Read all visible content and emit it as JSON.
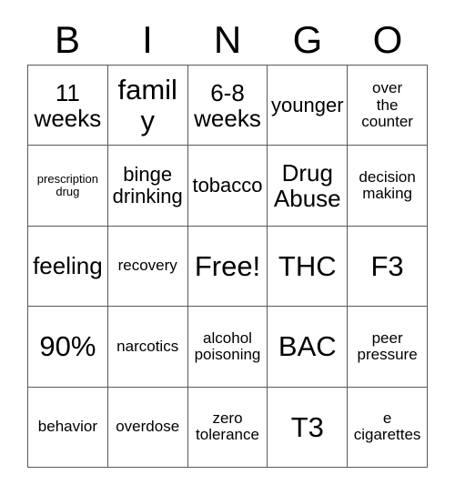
{
  "card": {
    "header_letters": [
      "B",
      "I",
      "N",
      "G",
      "O"
    ],
    "free_space_label": "Free!",
    "grid": {
      "columns": 5,
      "rows": 5,
      "cells": [
        {
          "text": "11\nweeks",
          "size": "lg"
        },
        {
          "text": "family",
          "size": "xl"
        },
        {
          "text": "6-8\nweeks",
          "size": "lg"
        },
        {
          "text": "younger",
          "size": "md"
        },
        {
          "text": "over\nthe\ncounter",
          "size": "sm"
        },
        {
          "text": "prescription\ndrug",
          "size": "xs"
        },
        {
          "text": "binge\ndrinking",
          "size": "md"
        },
        {
          "text": "tobacco",
          "size": "md"
        },
        {
          "text": "Drug\nAbuse",
          "size": "lg"
        },
        {
          "text": "decision\nmaking",
          "size": "sm"
        },
        {
          "text": "feeling",
          "size": "lg"
        },
        {
          "text": "recovery",
          "size": "sm"
        },
        {
          "text": "Free!",
          "size": "xl"
        },
        {
          "text": "THC",
          "size": "xl"
        },
        {
          "text": "F3",
          "size": "xl"
        },
        {
          "text": "90%",
          "size": "xl"
        },
        {
          "text": "narcotics",
          "size": "sm"
        },
        {
          "text": "alcohol\npoisoning",
          "size": "sm"
        },
        {
          "text": "BAC",
          "size": "xl"
        },
        {
          "text": "peer\npressure",
          "size": "sm"
        },
        {
          "text": "behavior",
          "size": "sm"
        },
        {
          "text": "overdose",
          "size": "sm"
        },
        {
          "text": "zero\ntolerance",
          "size": "sm"
        },
        {
          "text": "T3",
          "size": "xl"
        },
        {
          "text": "e\ncigarettes",
          "size": "sm"
        }
      ]
    }
  },
  "colors": {
    "background": "#ffffff",
    "text": "#000000",
    "grid_line": "#59595b"
  }
}
